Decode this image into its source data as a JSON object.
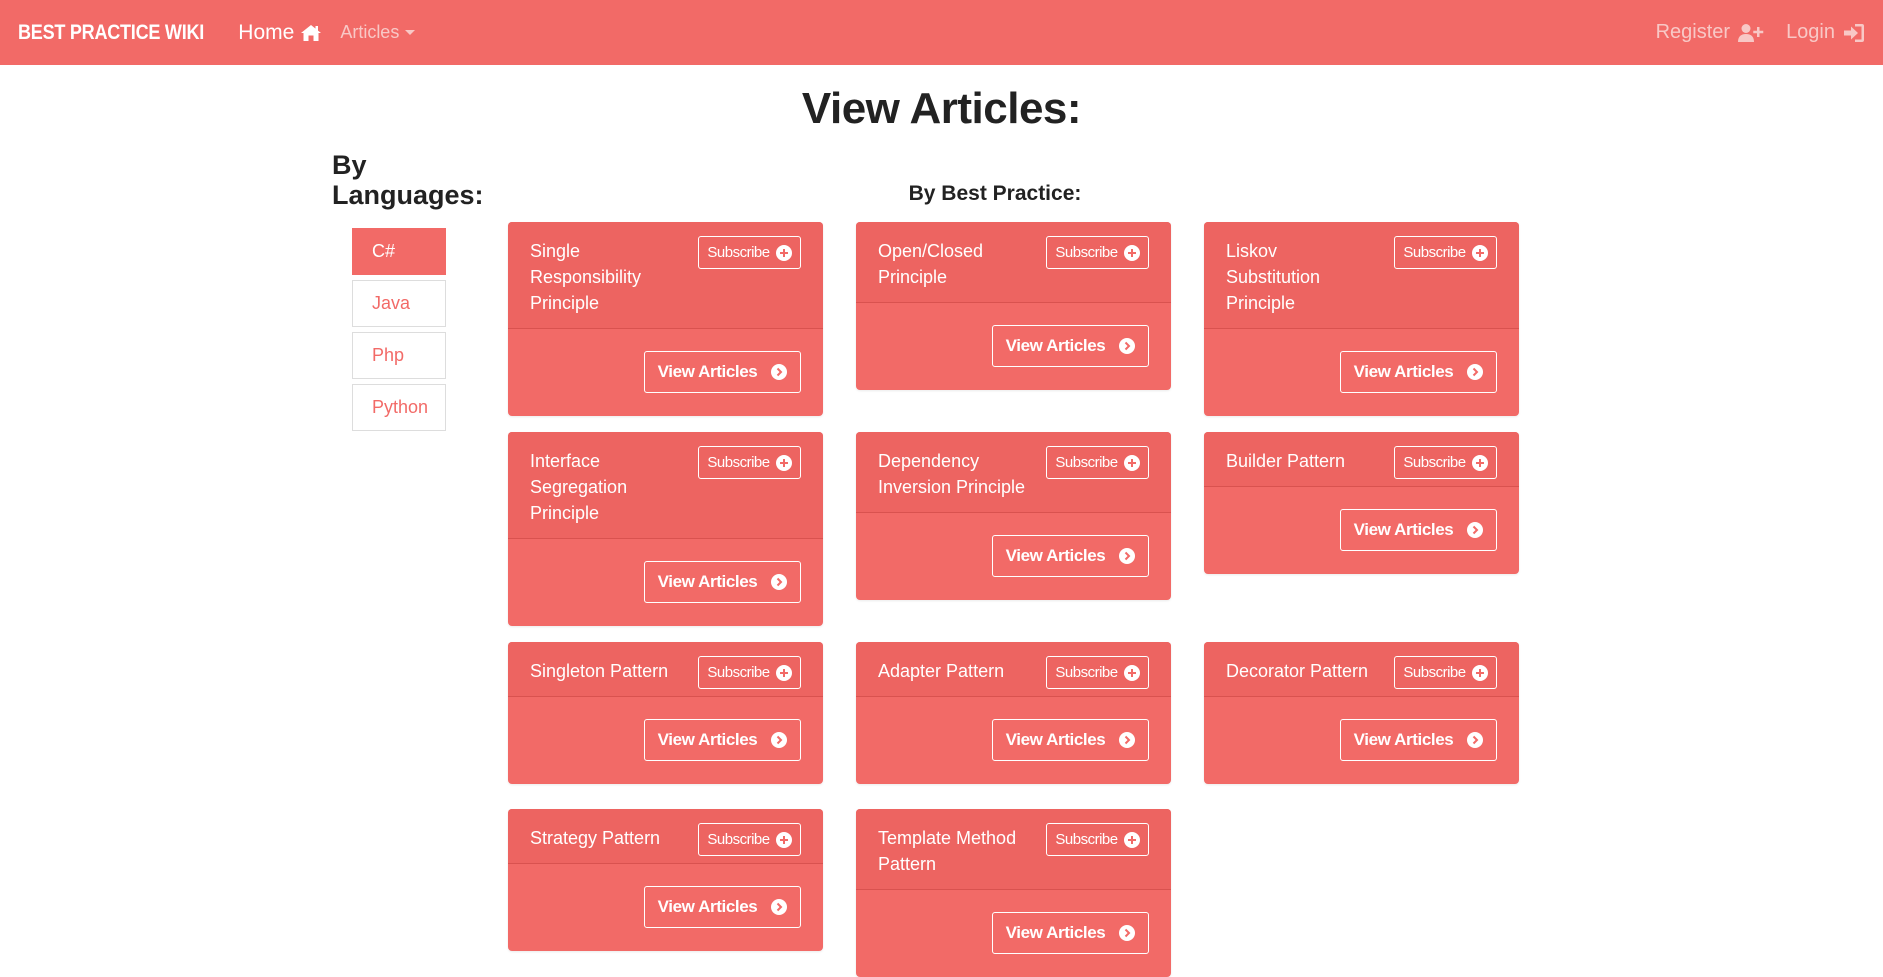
{
  "navbar": {
    "brand": "BEST PRACTICE WIKI",
    "home_label": "Home",
    "articles_label": "Articles",
    "register_label": "Register",
    "login_label": "Login",
    "bg_color": "#f26a67"
  },
  "page_title": "View Articles:",
  "languages": {
    "heading_line1": "By",
    "heading_line2": "Languages:",
    "items": [
      "C#",
      "Java",
      "Php",
      "Python"
    ],
    "active": "C#"
  },
  "best_practice_heading": "By Best Practice:",
  "cards": [
    {
      "title": "Single Responsibility Principle",
      "subscribe": "Subscribe",
      "view": "View Articles"
    },
    {
      "title": "Open/Closed Principle",
      "subscribe": "Subscribe",
      "view": "View Articles"
    },
    {
      "title": "Liskov Substitution Principle",
      "subscribe": "Subscribe",
      "view": "View Articles"
    },
    {
      "title": "Interface Segregation Principle",
      "subscribe": "Subscribe",
      "view": "View Articles"
    },
    {
      "title": "Dependency Inversion Principle",
      "subscribe": "Subscribe",
      "view": "View Articles"
    },
    {
      "title": "Builder Pattern",
      "subscribe": "Subscribe",
      "view": "View Articles"
    },
    {
      "title": "Singleton Pattern",
      "subscribe": "Subscribe",
      "view": "View Articles"
    },
    {
      "title": "Adapter Pattern",
      "subscribe": "Subscribe",
      "view": "View Articles"
    },
    {
      "title": "Decorator Pattern",
      "subscribe": "Subscribe",
      "view": "View Articles"
    },
    {
      "title": "Strategy Pattern",
      "subscribe": "Subscribe",
      "view": "View Articles"
    },
    {
      "title": "Template Method Pattern",
      "subscribe": "Subscribe",
      "view": "View Articles"
    }
  ]
}
